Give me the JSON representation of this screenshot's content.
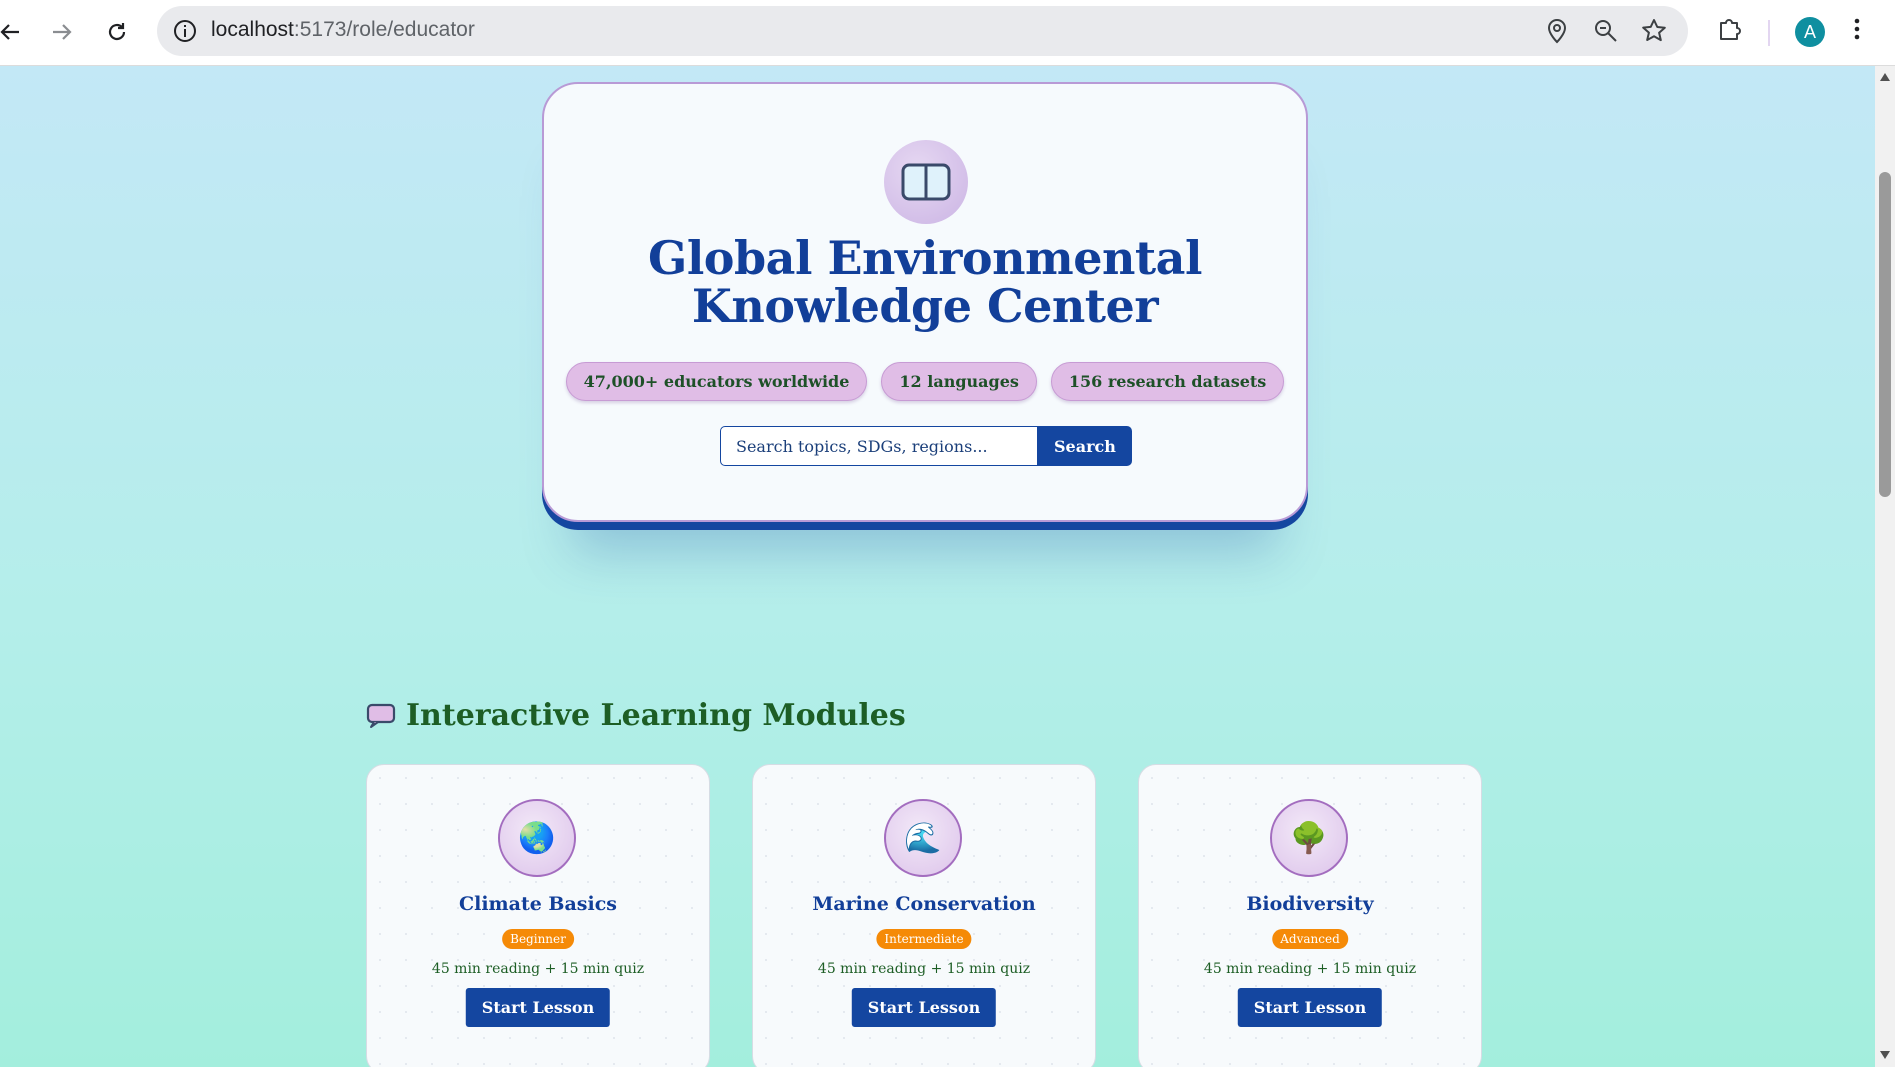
{
  "browser": {
    "url_host": "localhost",
    "url_path": ":5173/role/educator",
    "profile_initial": "A"
  },
  "hero": {
    "logo_icon": "book-panel-icon",
    "title_line1": "Global Environmental",
    "title_line2": "Knowledge Center",
    "stats": [
      "47,000+ educators worldwide",
      "12 languages",
      "156 research datasets"
    ],
    "search_placeholder": "Search topics, SDGs, regions...",
    "search_button": "Search"
  },
  "modules": {
    "heading": "Interactive Learning Modules",
    "heading_icon": "speech-bubble-icon",
    "items": [
      {
        "icon": "🌏",
        "title": "Climate Basics",
        "level": "Beginner",
        "meta": "45 min reading + 15 min quiz",
        "button": "Start Lesson"
      },
      {
        "icon": "🌊",
        "title": "Marine Conservation",
        "level": "Intermediate",
        "meta": "45 min reading + 15 min quiz",
        "button": "Start Lesson"
      },
      {
        "icon": "🌳",
        "title": "Biodiversity",
        "level": "Advanced",
        "meta": "45 min reading + 15 min quiz",
        "button": "Start Lesson"
      }
    ]
  },
  "colors": {
    "primary": "#1446a0",
    "accent_green": "#1d5e25",
    "pill_bg": "#e0bde6",
    "badge_orange": "#f58a07"
  }
}
